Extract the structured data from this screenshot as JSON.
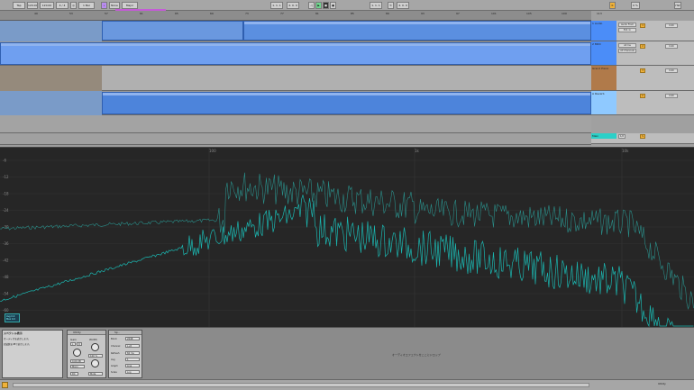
{
  "transport": {
    "tap": "Tap",
    "tempo": "120.00",
    "time_sig": "4 / 4",
    "loop_len": "1 Bar",
    "key": "None",
    "scale": "Major",
    "position": "1. 1. 1",
    "end": "4. 0. 0",
    "cpu": "0 %",
    "hw": "HW"
  },
  "ruler": {
    "bars": [
      "49",
      "53",
      "57",
      "61",
      "65",
      "69",
      "73",
      "77",
      "81",
      "85",
      "89",
      "93",
      "97",
      "101",
      "105",
      "109",
      "113"
    ]
  },
  "timeline": {
    "labels": [
      "5:05.000",
      "5:10.000",
      "5:15.000",
      "5:20.000",
      "5:25.000",
      "5:30.000",
      "5:35.000",
      "5:40.000",
      "5:45.000",
      "5:50.000",
      "5:55.000",
      "6:00.000",
      "6:05.000",
      "6:10.000",
      "6:15.000",
      "6:20.000",
      "6:25.000",
      "6:30.000"
    ],
    "fraction": "1/2"
  },
  "tracks": [
    {
      "name": "1 Audio",
      "color": "#4b8df8",
      "send": "Audio From",
      "sub": "Ext. In",
      "vol": "0.00"
    },
    {
      "name": "2 MIDI",
      "color": "#4b8df8",
      "send": "All Ins",
      "sub": "All Channels",
      "vol": "0.00"
    },
    {
      "name": "Grand Piano",
      "color": "#b07a4a",
      "send": "",
      "sub": "",
      "vol": "0.00"
    },
    {
      "name": "A Reverb",
      "color": "#8fc9ff",
      "send": "",
      "sub": "",
      "vol": "0.00"
    }
  ],
  "master": {
    "name": "Main",
    "value": "1/2"
  },
  "spectrum": {
    "freq_labels": [
      "100",
      "1k",
      "10k"
    ],
    "db_labels": [
      "-6",
      "-12",
      "-18",
      "-24",
      "-30",
      "-36",
      "-42",
      "-48",
      "-54",
      "-60"
    ],
    "readout1": "Avg 0.0",
    "readout2": "Max 0.0",
    "colors": {
      "line1": "#1bb6b0",
      "line2": "#2a8f8a"
    }
  },
  "devices": {
    "info_title": "スペクトル表示",
    "info_text1": "オーディオを表示します。",
    "info_text2": "周波数をdBで表示します。",
    "utility": {
      "title": "Utility",
      "gain_label": "Gain",
      "gain": "0.00 dB",
      "width_label": "Width",
      "width": "100 %",
      "mono": "Mono",
      "balance": "Balance",
      "dc": "DC",
      "mute": "Mute"
    },
    "spectrum_dev": {
      "title": "Sp..",
      "block": "Block",
      "block_val": "2048",
      "channel": "Channel",
      "channel_val": "L+R",
      "refresh": "Refresh",
      "refresh_val": "60 ms",
      "avg": "Avg",
      "avg_val": "1",
      "graph": "Graph",
      "graph_val": "Line",
      "scale": "Scale",
      "scale_val": "Log"
    },
    "drop_hint": "オーディオエフェクトをここにドロップ"
  },
  "status": {
    "track": "Utility"
  }
}
